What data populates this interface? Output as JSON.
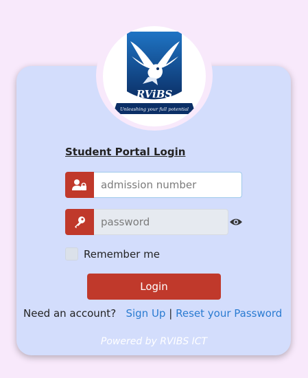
{
  "logo": {
    "brand": "RViBS",
    "tagline": "Unleashing your full potential"
  },
  "login": {
    "title": "Student Portal Login",
    "username_placeholder": "admission number",
    "username_value": "",
    "password_placeholder": "password",
    "password_value": "",
    "remember_label": "Remember me",
    "remember_checked": false,
    "submit_label": "Login"
  },
  "links": {
    "prompt": "Need an account?",
    "signup": "Sign Up",
    "separator": "|",
    "reset": "Reset your Password"
  },
  "footer": {
    "powered": "Powered by RVIBS ICT"
  },
  "colors": {
    "page_bg": "#f8e9fb",
    "card_bg": "#d3ddfc",
    "accent": "#c0392b",
    "link": "#2a7bd1"
  },
  "icons": {
    "username": "user-lock-icon",
    "password": "key-icon",
    "toggle_password": "eye-icon"
  }
}
